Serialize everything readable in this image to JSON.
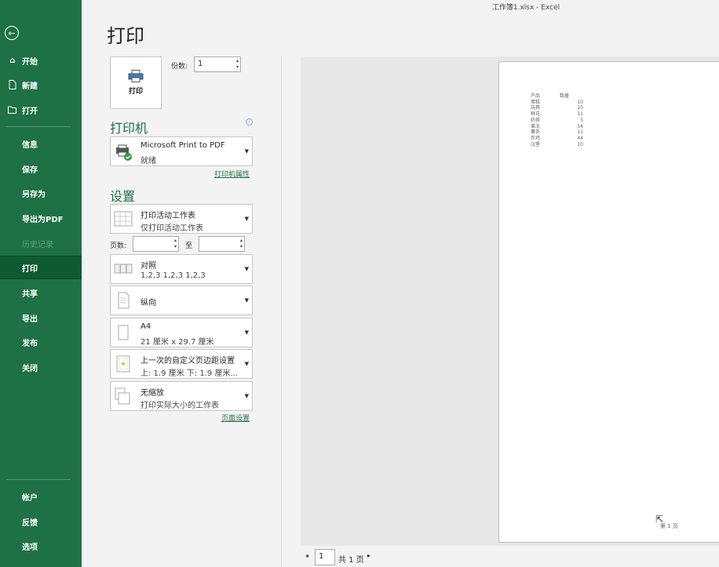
{
  "window": {
    "title": "工作簿1.xlsx  -  Excel"
  },
  "nav": {
    "back_icon": "arrow-left-circle-icon",
    "items": [
      {
        "label": "开始",
        "icon": "home-icon"
      },
      {
        "label": "新建",
        "icon": "new-document-icon"
      },
      {
        "label": "打开",
        "icon": "folder-open-icon"
      },
      {
        "label": "信息"
      },
      {
        "label": "保存"
      },
      {
        "label": "另存为"
      },
      {
        "label": "导出为PDF"
      },
      {
        "label": "历史记录",
        "disabled": true
      },
      {
        "label": "打印",
        "active": true
      },
      {
        "label": "共享"
      },
      {
        "label": "导出"
      },
      {
        "label": "发布"
      },
      {
        "label": "关闭"
      },
      {
        "label": "帐户"
      },
      {
        "label": "反馈"
      },
      {
        "label": "选项"
      }
    ]
  },
  "print": {
    "title": "打印",
    "button_label": "打印",
    "copies_label": "份数:",
    "copies_value": "1"
  },
  "printer": {
    "heading": "打印机",
    "name": "Microsoft Print to PDF",
    "status": "就绪",
    "properties_link": "打印机属性"
  },
  "settings": {
    "heading": "设置",
    "what": {
      "line1": "打印活动工作表",
      "line2": "仅打印活动工作表"
    },
    "pages_label": "页数:",
    "to_label": "至",
    "pages_from": "",
    "pages_to": "",
    "collate": {
      "line1": "对照",
      "line2": "1,2,3    1,2,3    1,2,3"
    },
    "orientation": {
      "line1": "纵向"
    },
    "paper": {
      "line1": "A4",
      "line2": "21 厘米 x 29.7 厘米"
    },
    "margins": {
      "line1": "上一次的自定义页边距设置",
      "line2": "上: 1.9 厘米 下: 1.9 厘米..."
    },
    "scaling": {
      "line1": "无缩放",
      "line2": "打印实际大小的工作表"
    },
    "page_setup_link": "页面设置"
  },
  "preview": {
    "table_headers": [
      "产品",
      "数量"
    ],
    "rows": [
      [
        "蛋糕",
        "10"
      ],
      [
        "玩具",
        "20"
      ],
      [
        "鲜花",
        "11"
      ],
      [
        "奶茶",
        "5"
      ],
      [
        "果冻",
        "54"
      ],
      [
        "薯条",
        "11"
      ],
      [
        "炸鸡",
        "44"
      ],
      [
        "汉堡",
        "10"
      ]
    ],
    "page_footer": "第 1 页"
  },
  "page_nav": {
    "current_page": "1",
    "total_label": "共 1 页"
  }
}
